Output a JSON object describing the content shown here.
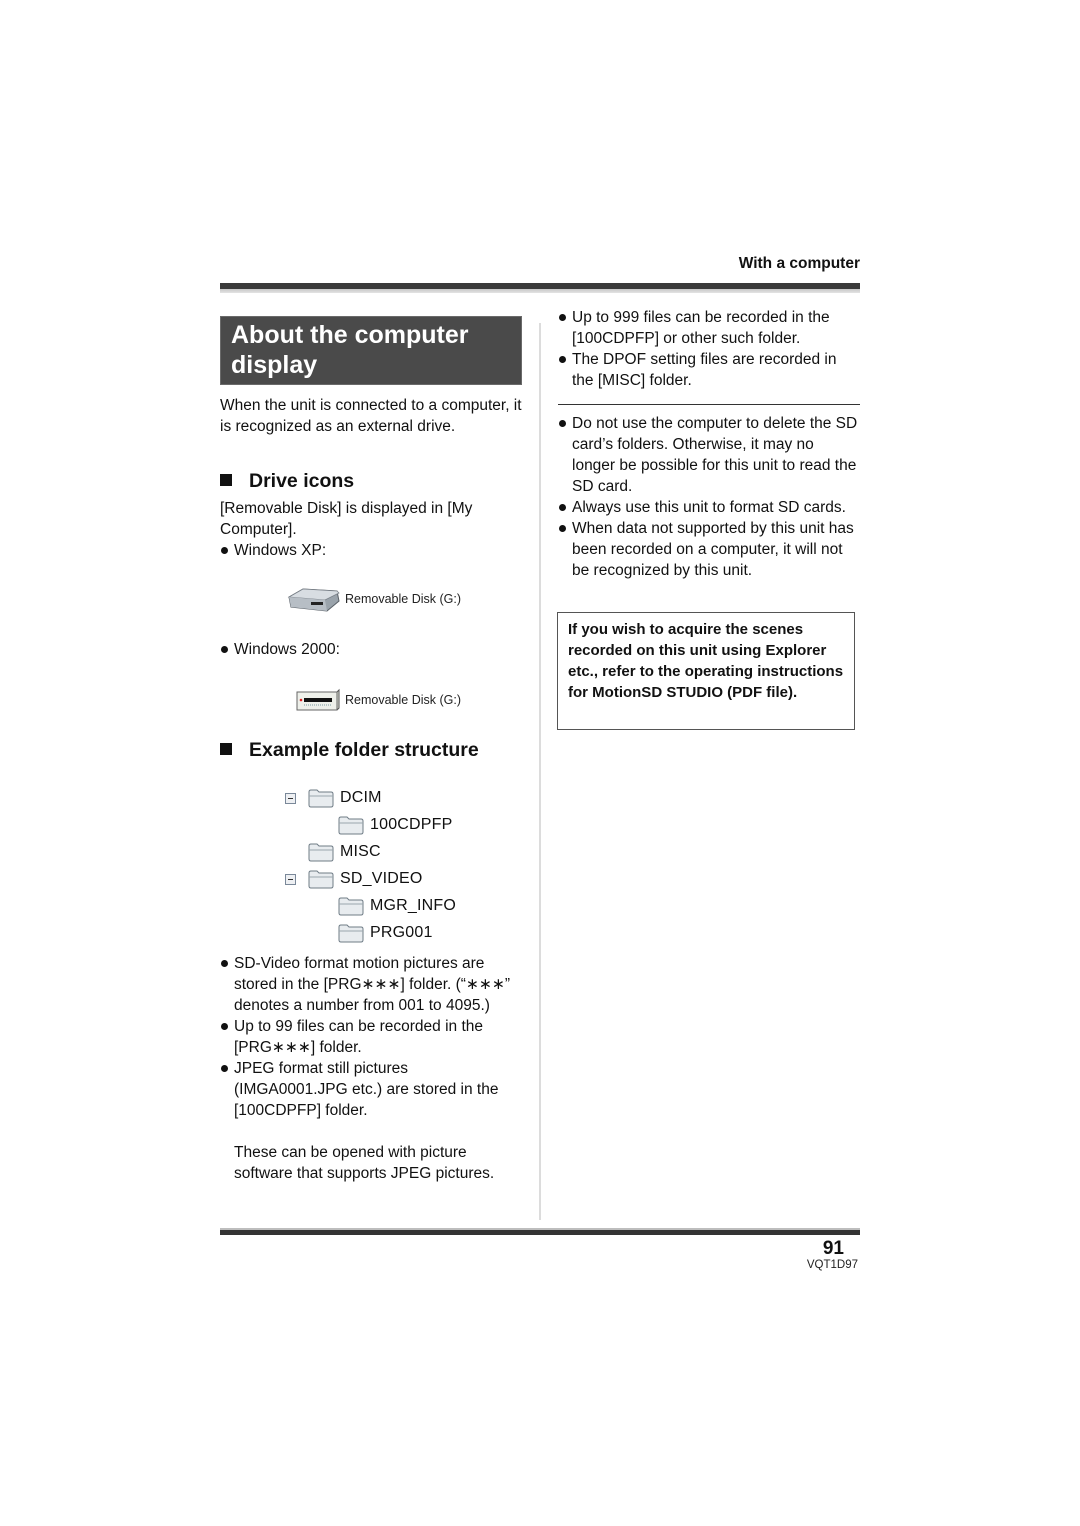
{
  "header": {
    "section_label": "With a computer"
  },
  "title": "About the computer display",
  "intro": "When the unit is connected to a computer, it is recognized as an external drive.",
  "drive_icons": {
    "heading": "Drive icons",
    "text": "[Removable Disk] is displayed in [My Computer].",
    "items": [
      {
        "os": "Windows XP:",
        "icon": "removable-disk-xp-icon",
        "label": "Removable Disk (G:)"
      },
      {
        "os": "Windows 2000:",
        "icon": "removable-disk-2000-icon",
        "label": "Removable Disk (G:)"
      }
    ]
  },
  "folder_structure": {
    "heading": "Example folder structure",
    "tree": [
      {
        "name": "DCIM",
        "level": 0,
        "expanded": true
      },
      {
        "name": "100CDPFP",
        "level": 1
      },
      {
        "name": "MISC",
        "level": 0
      },
      {
        "name": "SD_VIDEO",
        "level": 0,
        "expanded": true
      },
      {
        "name": "MGR_INFO",
        "level": 1
      },
      {
        "name": "PRG001",
        "level": 1
      }
    ],
    "bullets": [
      "SD-Video format motion pictures are stored in the [PRG∗∗∗] folder. (“∗∗∗” denotes a number from 001 to 4095.)",
      "Up to 99 files can be recorded in the [PRG∗∗∗] folder.",
      "JPEG format still pictures (IMGA0001.JPG etc.) are stored in the [100CDPFP] folder.",
      "These can be opened with picture software that supports JPEG pictures."
    ]
  },
  "right_column": {
    "bullets_top": [
      "Up to 999 files can be recorded in the [100CDPFP] or other such folder.",
      "The DPOF setting files are recorded in the [MISC] folder."
    ],
    "bullets_bottom": [
      "Do not use the computer to delete the SD card’s folders. Otherwise, it may no longer be possible for this unit to read the SD card.",
      "Always use this unit to format SD cards.",
      "When data not supported by this unit has been recorded on a computer, it will not be recognized by this unit."
    ],
    "note": "If you wish to acquire the scenes recorded on this unit using Explorer etc., refer to the operating instructions for MotionSD STUDIO (PDF file)."
  },
  "footer": {
    "page_number": "91",
    "doc_code": "VQT1D97"
  }
}
